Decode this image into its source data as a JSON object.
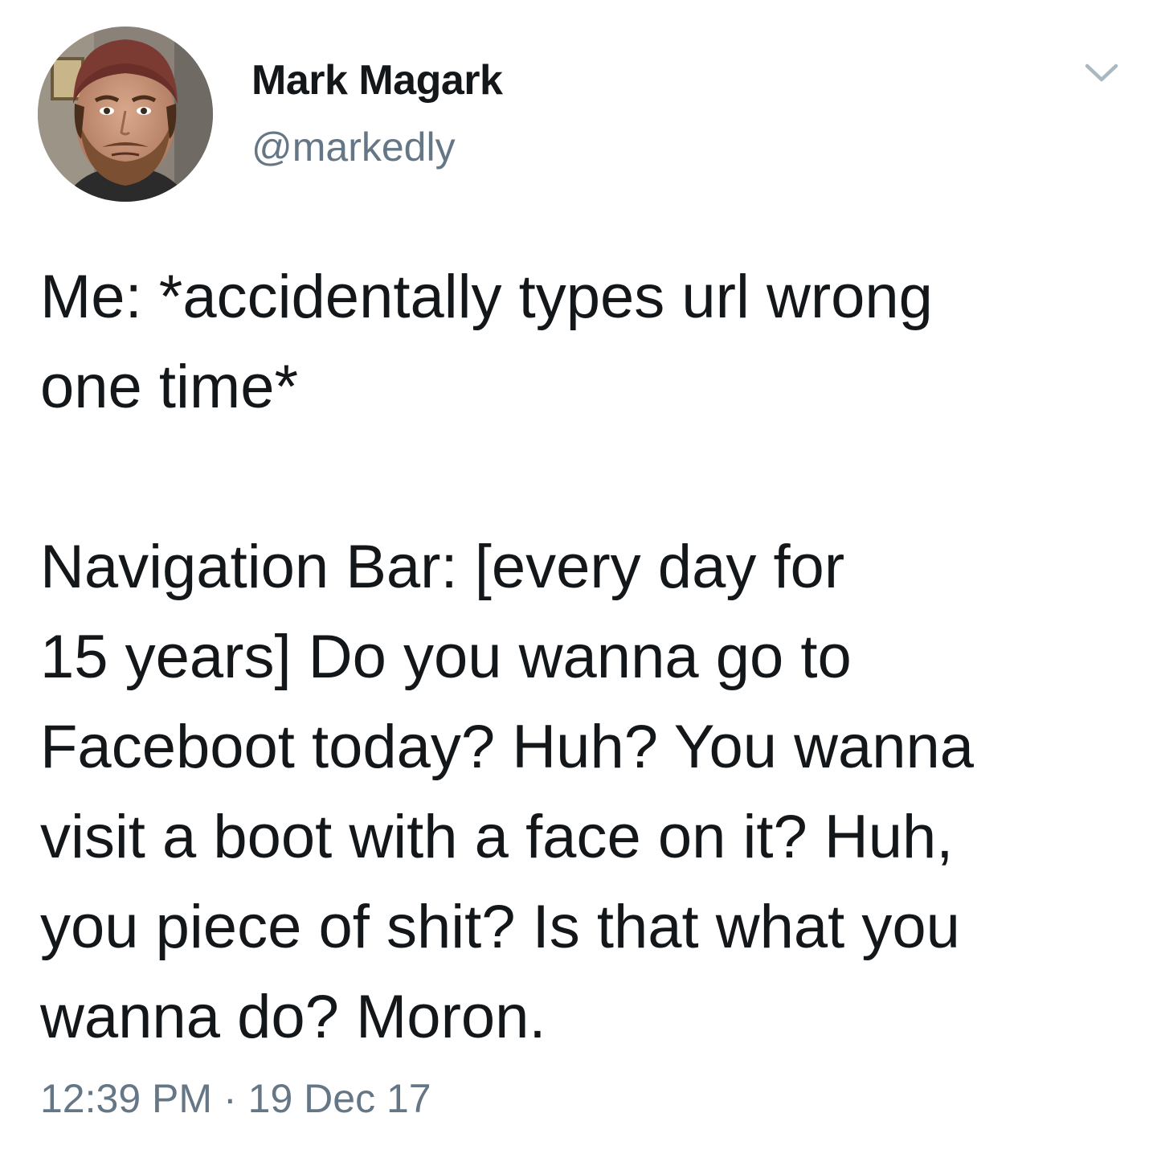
{
  "author": {
    "display_name": "Mark Magark",
    "handle": "@markedly",
    "avatar_icon": "user-avatar-photo"
  },
  "menu": {
    "icon": "chevron-down-icon",
    "color": "#aab8c2"
  },
  "tweet": {
    "text": "Me: *accidentally types url wrong\none time*\n\nNavigation Bar: [every day for\n15 years] Do you wanna go to\nFaceboot today? Huh? You wanna\nvisit a boot with a face on it? Huh,\nyou piece of shit? Is that what you\nwanna do? Moron."
  },
  "meta": {
    "time": "12:39 PM",
    "separator": "·",
    "date": "19 Dec 17"
  },
  "colors": {
    "text": "#14171a",
    "secondary": "#657786",
    "background": "#ffffff"
  }
}
